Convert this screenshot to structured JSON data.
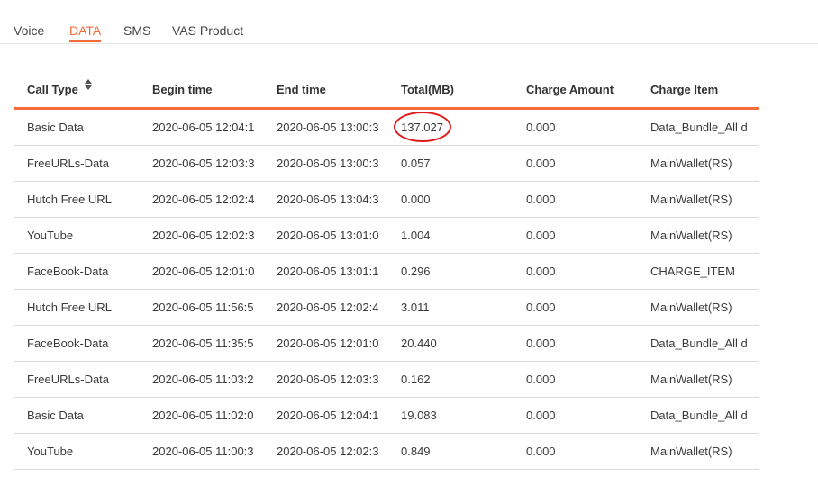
{
  "tabs": [
    {
      "label": "Voice",
      "active": false
    },
    {
      "label": "DATA",
      "active": true
    },
    {
      "label": "SMS",
      "active": false
    },
    {
      "label": "VAS Product",
      "active": false
    }
  ],
  "accent_color": "#f26b38",
  "annotation_color": "#e01a1a",
  "table": {
    "headers": [
      "Call Type",
      "Begin time",
      "End time",
      "Total(MB)",
      "Charge Amount",
      "Charge Item"
    ],
    "sort_icon": "sort-updown-icon",
    "rows": [
      [
        "Basic Data",
        "2020-06-05 12:04:1",
        "2020-06-05 13:00:3",
        "137.027",
        "0.000",
        "Data_Bundle_All d"
      ],
      [
        "FreeURLs-Data",
        "2020-06-05 12:03:3",
        "2020-06-05 13:00:3",
        "0.057",
        "0.000",
        "MainWallet(RS)"
      ],
      [
        "Hutch Free URL",
        "2020-06-05 12:02:4",
        "2020-06-05 13:04:3",
        "0.000",
        "0.000",
        "MainWallet(RS)"
      ],
      [
        "YouTube",
        "2020-06-05 12:02:3",
        "2020-06-05 13:01:0",
        "1.004",
        "0.000",
        "MainWallet(RS)"
      ],
      [
        "FaceBook-Data",
        "2020-06-05 12:01:0",
        "2020-06-05 13:01:1",
        "0.296",
        "0.000",
        "CHARGE_ITEM"
      ],
      [
        "Hutch Free URL",
        "2020-06-05 11:56:5",
        "2020-06-05 12:02:4",
        "3.011",
        "0.000",
        "MainWallet(RS)"
      ],
      [
        "FaceBook-Data",
        "2020-06-05 11:35:5",
        "2020-06-05 12:01:0",
        "20.440",
        "0.000",
        "Data_Bundle_All d"
      ],
      [
        "FreeURLs-Data",
        "2020-06-05 11:03:2",
        "2020-06-05 12:03:3",
        "0.162",
        "0.000",
        "MainWallet(RS)"
      ],
      [
        "Basic Data",
        "2020-06-05 11:02:0",
        "2020-06-05 12:04:1",
        "19.083",
        "0.000",
        "Data_Bundle_All d"
      ],
      [
        "YouTube",
        "2020-06-05 11:00:3",
        "2020-06-05 12:02:3",
        "0.849",
        "0.000",
        "MainWallet(RS)"
      ]
    ]
  }
}
